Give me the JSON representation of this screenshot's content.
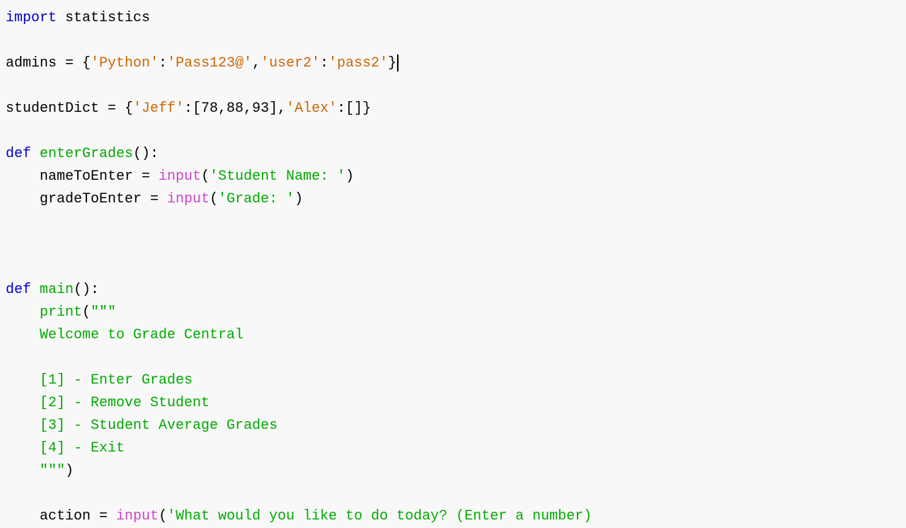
{
  "code": {
    "lines": [
      {
        "id": "line1",
        "parts": [
          {
            "type": "kw-import",
            "text": "import"
          },
          {
            "type": "kw-module",
            "text": " statistics"
          }
        ]
      },
      {
        "id": "line2",
        "parts": []
      },
      {
        "id": "line3",
        "parts": [
          {
            "type": "var-default",
            "text": "admins = {"
          },
          {
            "type": "str-orange",
            "text": "'Python'"
          },
          {
            "type": "var-default",
            "text": ":"
          },
          {
            "type": "str-orange",
            "text": "'Pass123@'"
          },
          {
            "type": "var-default",
            "text": ","
          },
          {
            "type": "str-orange",
            "text": "'user2'"
          },
          {
            "type": "var-default",
            "text": ":"
          },
          {
            "type": "str-orange",
            "text": "'pass2'"
          },
          {
            "type": "var-default",
            "text": "}"
          },
          {
            "type": "cursor-marker",
            "text": ""
          }
        ]
      },
      {
        "id": "line4",
        "parts": []
      },
      {
        "id": "line5",
        "parts": [
          {
            "type": "var-default",
            "text": "studentDict = {"
          },
          {
            "type": "str-orange",
            "text": "'Jeff'"
          },
          {
            "type": "var-default",
            "text": ":[78,88,93],"
          },
          {
            "type": "str-orange",
            "text": "'Alex'"
          },
          {
            "type": "var-default",
            "text": ":[]}"
          }
        ]
      },
      {
        "id": "line6",
        "parts": []
      },
      {
        "id": "line7",
        "parts": [
          {
            "type": "kw-def",
            "text": "def "
          },
          {
            "type": "kw-funcname",
            "text": "enterGrades"
          },
          {
            "type": "var-default",
            "text": "():"
          }
        ]
      },
      {
        "id": "line8",
        "parts": [
          {
            "type": "indent",
            "text": "    "
          },
          {
            "type": "var-default",
            "text": "nameToEnter = "
          },
          {
            "type": "kw-input",
            "text": "input"
          },
          {
            "type": "var-default",
            "text": "("
          },
          {
            "type": "str-green",
            "text": "'Student Name: '"
          },
          {
            "type": "var-default",
            "text": ")"
          }
        ]
      },
      {
        "id": "line9",
        "parts": [
          {
            "type": "indent",
            "text": "    "
          },
          {
            "type": "var-default",
            "text": "gradeToEnter = "
          },
          {
            "type": "kw-input",
            "text": "input"
          },
          {
            "type": "var-default",
            "text": "("
          },
          {
            "type": "str-green",
            "text": "'Grade: '"
          },
          {
            "type": "var-default",
            "text": ")"
          }
        ]
      },
      {
        "id": "line10",
        "parts": []
      },
      {
        "id": "line11",
        "parts": []
      },
      {
        "id": "line12",
        "parts": []
      },
      {
        "id": "line13",
        "parts": [
          {
            "type": "kw-def",
            "text": "def "
          },
          {
            "type": "kw-funcname",
            "text": "main"
          },
          {
            "type": "var-default",
            "text": "():"
          }
        ]
      },
      {
        "id": "line14",
        "parts": [
          {
            "type": "indent",
            "text": "    "
          },
          {
            "type": "kw-print",
            "text": "print"
          },
          {
            "type": "var-default",
            "text": "("
          },
          {
            "type": "str-green",
            "text": "\"\"\""
          }
        ]
      },
      {
        "id": "line15",
        "parts": [
          {
            "type": "indent",
            "text": "    "
          },
          {
            "type": "str-green",
            "text": "Welcome to Grade Central"
          }
        ]
      },
      {
        "id": "line16",
        "parts": []
      },
      {
        "id": "line17",
        "parts": [
          {
            "type": "indent",
            "text": "    "
          },
          {
            "type": "str-green",
            "text": "[1] - Enter Grades"
          }
        ]
      },
      {
        "id": "line18",
        "parts": [
          {
            "type": "indent",
            "text": "    "
          },
          {
            "type": "str-green",
            "text": "[2] - Remove Student"
          }
        ]
      },
      {
        "id": "line19",
        "parts": [
          {
            "type": "indent",
            "text": "    "
          },
          {
            "type": "str-green",
            "text": "[3] - Student Average Grades"
          }
        ]
      },
      {
        "id": "line20",
        "parts": [
          {
            "type": "indent",
            "text": "    "
          },
          {
            "type": "str-green",
            "text": "[4] - Exit"
          }
        ]
      },
      {
        "id": "line21",
        "parts": [
          {
            "type": "indent",
            "text": "    "
          },
          {
            "type": "str-green",
            "text": "\"\"\""
          },
          {
            "type": "var-default",
            "text": ")"
          }
        ]
      },
      {
        "id": "line22",
        "parts": []
      },
      {
        "id": "line23",
        "parts": [
          {
            "type": "indent",
            "text": "    "
          },
          {
            "type": "var-default",
            "text": "action = "
          },
          {
            "type": "kw-input",
            "text": "input"
          },
          {
            "type": "var-default",
            "text": "("
          },
          {
            "type": "str-green",
            "text": "'What would you like to do today? (Enter a number)"
          },
          {
            "type": "ellipsis",
            "text": "..."
          }
        ]
      }
    ]
  }
}
